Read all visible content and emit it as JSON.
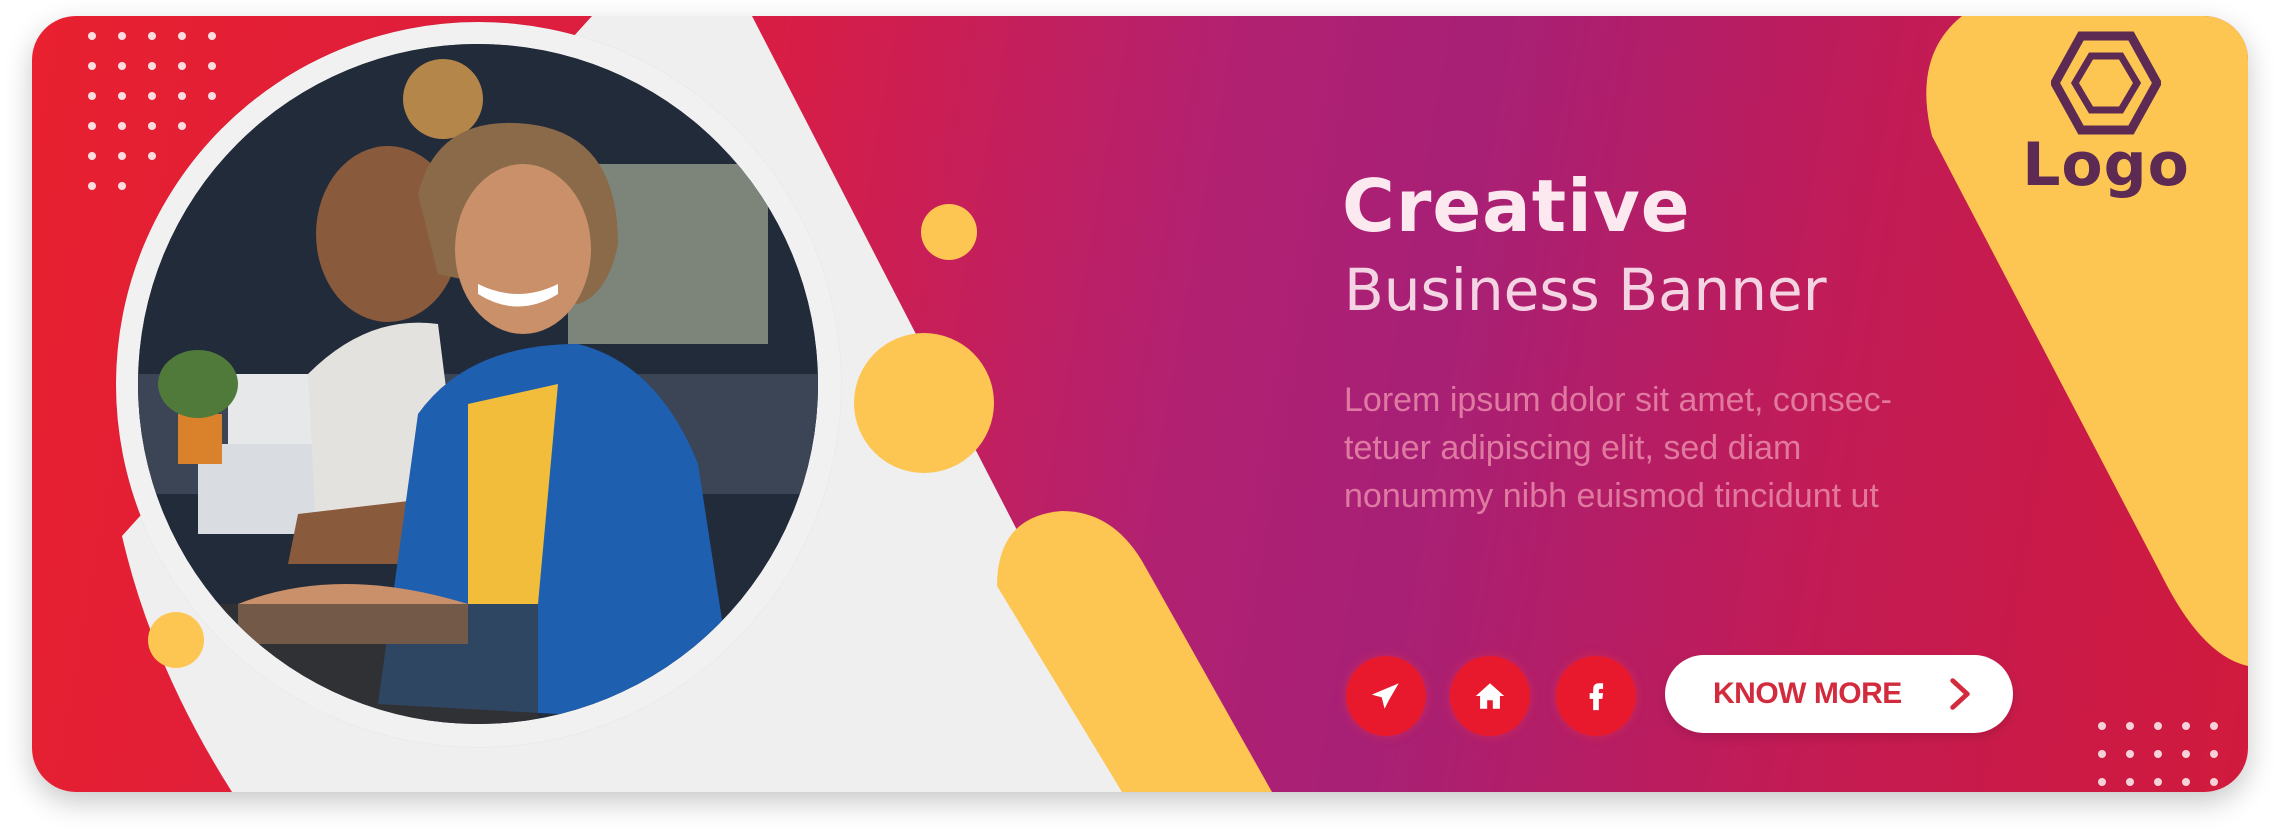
{
  "banner": {
    "headline_line1": "Creative",
    "headline_line2": "Business Banner",
    "body_lines": [
      "Lorem ipsum dolor sit amet, consec-",
      "tetuer adipiscing elit, sed diam",
      "nonummy nibh euismod tincidunt ut"
    ],
    "cta_label": "KNOW MORE",
    "logo_text": "Logo"
  },
  "social_icons": [
    "telegram-icon",
    "home-icon",
    "facebook-icon"
  ],
  "colors": {
    "primary_red": "#e8202f",
    "magenta": "#a72076",
    "accent_yellow": "#fdc652",
    "cream": "#f1f1f1",
    "logo_purple": "#5c2a52",
    "cta_text": "#d32b3e"
  }
}
